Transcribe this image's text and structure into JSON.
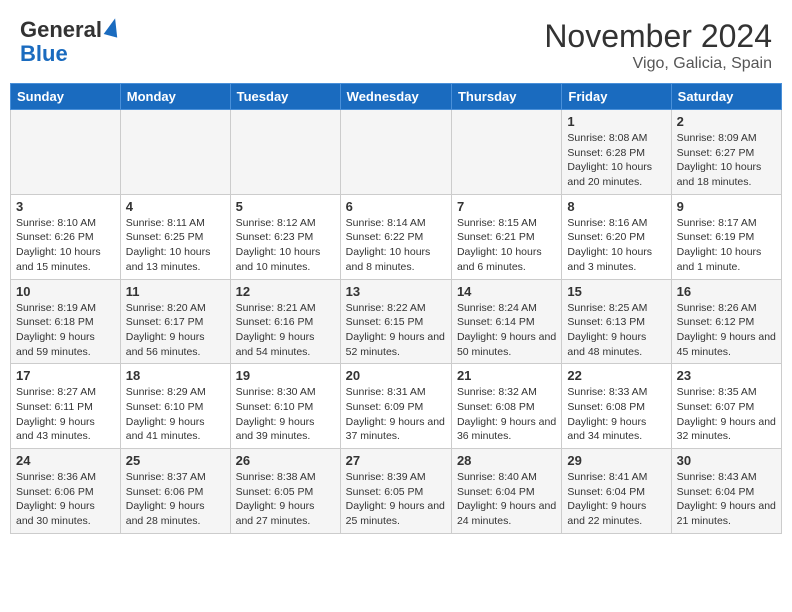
{
  "header": {
    "logo_line1": "General",
    "logo_line2": "Blue",
    "month_year": "November 2024",
    "location": "Vigo, Galicia, Spain"
  },
  "weekdays": [
    "Sunday",
    "Monday",
    "Tuesday",
    "Wednesday",
    "Thursday",
    "Friday",
    "Saturday"
  ],
  "weeks": [
    [
      {
        "day": "",
        "info": ""
      },
      {
        "day": "",
        "info": ""
      },
      {
        "day": "",
        "info": ""
      },
      {
        "day": "",
        "info": ""
      },
      {
        "day": "",
        "info": ""
      },
      {
        "day": "1",
        "info": "Sunrise: 8:08 AM\nSunset: 6:28 PM\nDaylight: 10 hours and 20 minutes."
      },
      {
        "day": "2",
        "info": "Sunrise: 8:09 AM\nSunset: 6:27 PM\nDaylight: 10 hours and 18 minutes."
      }
    ],
    [
      {
        "day": "3",
        "info": "Sunrise: 8:10 AM\nSunset: 6:26 PM\nDaylight: 10 hours and 15 minutes."
      },
      {
        "day": "4",
        "info": "Sunrise: 8:11 AM\nSunset: 6:25 PM\nDaylight: 10 hours and 13 minutes."
      },
      {
        "day": "5",
        "info": "Sunrise: 8:12 AM\nSunset: 6:23 PM\nDaylight: 10 hours and 10 minutes."
      },
      {
        "day": "6",
        "info": "Sunrise: 8:14 AM\nSunset: 6:22 PM\nDaylight: 10 hours and 8 minutes."
      },
      {
        "day": "7",
        "info": "Sunrise: 8:15 AM\nSunset: 6:21 PM\nDaylight: 10 hours and 6 minutes."
      },
      {
        "day": "8",
        "info": "Sunrise: 8:16 AM\nSunset: 6:20 PM\nDaylight: 10 hours and 3 minutes."
      },
      {
        "day": "9",
        "info": "Sunrise: 8:17 AM\nSunset: 6:19 PM\nDaylight: 10 hours and 1 minute."
      }
    ],
    [
      {
        "day": "10",
        "info": "Sunrise: 8:19 AM\nSunset: 6:18 PM\nDaylight: 9 hours and 59 minutes."
      },
      {
        "day": "11",
        "info": "Sunrise: 8:20 AM\nSunset: 6:17 PM\nDaylight: 9 hours and 56 minutes."
      },
      {
        "day": "12",
        "info": "Sunrise: 8:21 AM\nSunset: 6:16 PM\nDaylight: 9 hours and 54 minutes."
      },
      {
        "day": "13",
        "info": "Sunrise: 8:22 AM\nSunset: 6:15 PM\nDaylight: 9 hours and 52 minutes."
      },
      {
        "day": "14",
        "info": "Sunrise: 8:24 AM\nSunset: 6:14 PM\nDaylight: 9 hours and 50 minutes."
      },
      {
        "day": "15",
        "info": "Sunrise: 8:25 AM\nSunset: 6:13 PM\nDaylight: 9 hours and 48 minutes."
      },
      {
        "day": "16",
        "info": "Sunrise: 8:26 AM\nSunset: 6:12 PM\nDaylight: 9 hours and 45 minutes."
      }
    ],
    [
      {
        "day": "17",
        "info": "Sunrise: 8:27 AM\nSunset: 6:11 PM\nDaylight: 9 hours and 43 minutes."
      },
      {
        "day": "18",
        "info": "Sunrise: 8:29 AM\nSunset: 6:10 PM\nDaylight: 9 hours and 41 minutes."
      },
      {
        "day": "19",
        "info": "Sunrise: 8:30 AM\nSunset: 6:10 PM\nDaylight: 9 hours and 39 minutes."
      },
      {
        "day": "20",
        "info": "Sunrise: 8:31 AM\nSunset: 6:09 PM\nDaylight: 9 hours and 37 minutes."
      },
      {
        "day": "21",
        "info": "Sunrise: 8:32 AM\nSunset: 6:08 PM\nDaylight: 9 hours and 36 minutes."
      },
      {
        "day": "22",
        "info": "Sunrise: 8:33 AM\nSunset: 6:08 PM\nDaylight: 9 hours and 34 minutes."
      },
      {
        "day": "23",
        "info": "Sunrise: 8:35 AM\nSunset: 6:07 PM\nDaylight: 9 hours and 32 minutes."
      }
    ],
    [
      {
        "day": "24",
        "info": "Sunrise: 8:36 AM\nSunset: 6:06 PM\nDaylight: 9 hours and 30 minutes."
      },
      {
        "day": "25",
        "info": "Sunrise: 8:37 AM\nSunset: 6:06 PM\nDaylight: 9 hours and 28 minutes."
      },
      {
        "day": "26",
        "info": "Sunrise: 8:38 AM\nSunset: 6:05 PM\nDaylight: 9 hours and 27 minutes."
      },
      {
        "day": "27",
        "info": "Sunrise: 8:39 AM\nSunset: 6:05 PM\nDaylight: 9 hours and 25 minutes."
      },
      {
        "day": "28",
        "info": "Sunrise: 8:40 AM\nSunset: 6:04 PM\nDaylight: 9 hours and 24 minutes."
      },
      {
        "day": "29",
        "info": "Sunrise: 8:41 AM\nSunset: 6:04 PM\nDaylight: 9 hours and 22 minutes."
      },
      {
        "day": "30",
        "info": "Sunrise: 8:43 AM\nSunset: 6:04 PM\nDaylight: 9 hours and 21 minutes."
      }
    ]
  ]
}
